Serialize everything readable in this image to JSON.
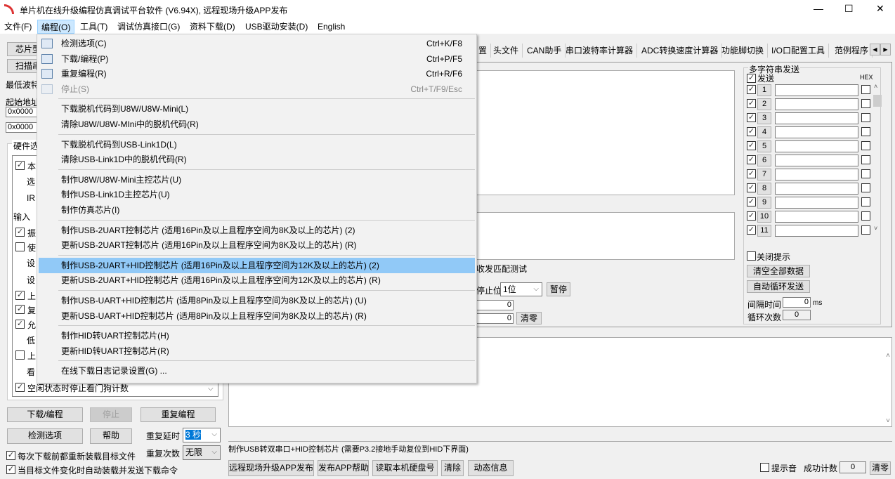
{
  "title": "单片机在线升级编程仿真调试平台软件 (V6.94X), 远程现场升级APP发布",
  "window": {
    "minimize": "—",
    "maximize": "☐",
    "close": "✕"
  },
  "menubar": [
    "文件(F)",
    "编程(O)",
    "工具(T)",
    "调试仿真接口(G)",
    "资料下载(D)",
    "USB驱动安装(D)",
    "English"
  ],
  "menu": [
    {
      "label": "检测选项(C)",
      "shortcut": "Ctrl+K/F8",
      "icon": "detect-icon"
    },
    {
      "label": "下载/编程(P)",
      "shortcut": "Ctrl+P/F5",
      "icon": "download-icon"
    },
    {
      "label": "重复编程(R)",
      "shortcut": "Ctrl+R/F6",
      "icon": "repeat-icon"
    },
    {
      "label": "停止(S)",
      "shortcut": "Ctrl+T/F9/Esc",
      "icon": "stop-icon",
      "disabled": true
    },
    {
      "sep": true
    },
    {
      "label": "下载脱机代码到U8W/U8W-Mini(L)"
    },
    {
      "label": "清除U8W/U8W-MIni中的脱机代码(R)"
    },
    {
      "sep": true
    },
    {
      "label": "下载脱机代码到USB-Link1D(L)"
    },
    {
      "label": "清除USB-Link1D中的脱机代码(R)"
    },
    {
      "sep": true
    },
    {
      "label": "制作U8W/U8W-Mini主控芯片(U)"
    },
    {
      "label": "制作USB-Link1D主控芯片(U)"
    },
    {
      "label": "制作仿真芯片(I)"
    },
    {
      "sep": true
    },
    {
      "label": "制作USB-2UART控制芯片 (适用16Pin及以上且程序空间为8K及以上的芯片) (2)"
    },
    {
      "label": "更新USB-2UART控制芯片 (适用16Pin及以上且程序空间为8K及以上的芯片) (R)"
    },
    {
      "sep": true
    },
    {
      "label": "制作USB-2UART+HID控制芯片 (适用16Pin及以上且程序空间为12K及以上的芯片) (2)",
      "highlighted": true
    },
    {
      "label": "更新USB-2UART+HID控制芯片 (适用16Pin及以上且程序空间为12K及以上的芯片) (R)"
    },
    {
      "sep": true
    },
    {
      "label": "制作USB-UART+HID控制芯片 (适用8Pin及以上且程序空间为8K及以上的芯片) (U)"
    },
    {
      "label": "更新USB-UART+HID控制芯片 (适用8Pin及以上且程序空间为8K及以上的芯片) (R)"
    },
    {
      "sep": true
    },
    {
      "label": "制作HID转UART控制芯片(H)"
    },
    {
      "label": "更新HID转UART控制芯片(R)"
    },
    {
      "sep": true
    },
    {
      "label": "在线下载日志记录设置(G) ..."
    }
  ],
  "left": {
    "chip_btn": "芯片型",
    "scan_btn": "扫描串",
    "min_baud": "最低波特",
    "start_addr": "起始地址",
    "addr1": "0x0000",
    "addr2": "0x0000",
    "hw_group": "硬件选",
    "opts": [
      {
        "t": "本",
        "c": true
      },
      {
        "t": "选"
      },
      {
        "t": "IR"
      },
      {
        "t": "输入"
      },
      {
        "t": "振",
        "c": true
      },
      {
        "t": "使",
        "c": false
      },
      {
        "t": "设"
      },
      {
        "t": "设"
      },
      {
        "t": "上",
        "c": true
      },
      {
        "t": "复",
        "c": true
      },
      {
        "t": "允",
        "c": true
      },
      {
        "t": "低"
      },
      {
        "t": "上",
        "c": false
      },
      {
        "t": "看"
      },
      {
        "t": "空闲状态时停止看门狗计数",
        "c": true
      }
    ],
    "download": "下载/编程",
    "stop": "停止",
    "repeat": "重复编程",
    "detect": "检测选项",
    "help": "帮助",
    "repeat_delay_label": "重复延时",
    "repeat_delay": "3 秒",
    "repeat_count_label": "重复次数",
    "repeat_count": "无限",
    "reload": "每次下载前都重新装载目标文件",
    "autoload": "当目标文件变化时自动装载并发送下载命令"
  },
  "tabs": [
    "置",
    "头文件",
    "CAN助手",
    "串口波特率计算器",
    "ADC转换速度计算器",
    "功能脚切换",
    "I/O口配置工具",
    "范例程序"
  ],
  "serial": {
    "match_test": "收发匹配测试",
    "stop_bits_label": "停止位",
    "stop_bits": "1位",
    "pause": "暂停",
    "rx": "0",
    "tx": "0",
    "clear": "清零"
  },
  "multi": {
    "title": "多字符串发送",
    "send": "发送",
    "hex": "HEX",
    "rows": [
      "1",
      "2",
      "3",
      "4",
      "5",
      "6",
      "7",
      "8",
      "9",
      "10",
      "11"
    ],
    "close_tip": "关闭提示",
    "clear_all": "清空全部数据",
    "auto_loop": "自动循环发送",
    "interval_label": "间隔时间",
    "interval": "0",
    "ms": "ms",
    "loop_label": "循环次数",
    "loop": "0"
  },
  "status": "制作USB转双串口+HID控制芯片 (需要P3.2接地手动复位到HID下界面)",
  "bottom": {
    "publish": "远程现场升级APP发布",
    "publish_help": "发布APP帮助",
    "read_disk": "读取本机硬盘号",
    "clear": "清除",
    "dynamic": "动态信息",
    "beep": "提示音",
    "success_label": "成功计数",
    "success": "0",
    "zero": "清零"
  }
}
